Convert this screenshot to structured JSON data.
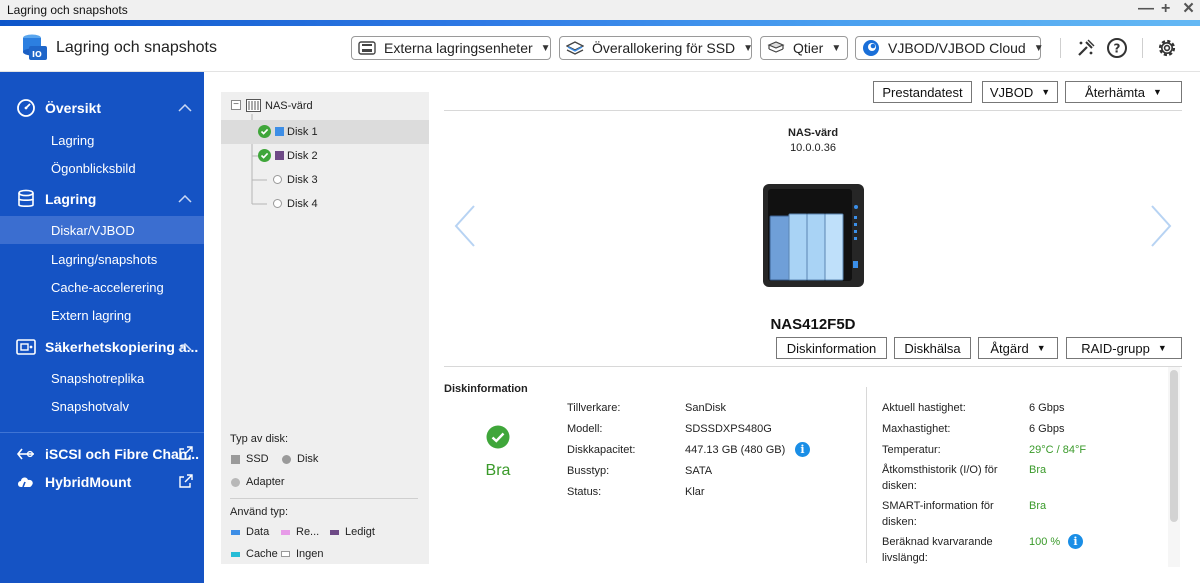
{
  "window": {
    "title": "Lagring och snapshots",
    "minimize": "—",
    "maximize": "+",
    "close": "×"
  },
  "header": {
    "app_name": "Lagring och snapshots",
    "buttons": {
      "external": "Externa lagringsenheter",
      "ssd": "Överallokering för SSD",
      "qtier": "Qtier",
      "vjbod": "VJBOD/VJBOD Cloud"
    },
    "accent": "#1553c4"
  },
  "sidebar": {
    "overview": "Översikt",
    "overview_items": [
      "Lagring",
      "Ögonblicksbild"
    ],
    "storage": "Lagring",
    "storage_items": [
      "Diskar/VJBOD",
      "Lagring/snapshots",
      "Cache-accelerering",
      "Extern lagring"
    ],
    "backup": "Säkerhetskopiering a...",
    "backup_items": [
      "Snapshotreplika",
      "Snapshotvalv"
    ],
    "iscsi": "iSCSI och Fibre Chan...",
    "hybridmount": "HybridMount"
  },
  "tree": {
    "root": "NAS-värd",
    "disks": [
      {
        "label": "Disk 1",
        "state": "ok",
        "color": "#3d8ee6"
      },
      {
        "label": "Disk 2",
        "state": "ok",
        "color": "#6e4a86"
      },
      {
        "label": "Disk 3",
        "state": "empty"
      },
      {
        "label": "Disk 4",
        "state": "empty"
      }
    ],
    "disk_type_title": "Typ av disk:",
    "disk_types": [
      "SSD",
      "Disk",
      "Adapter"
    ],
    "usage_title": "Använd typ:",
    "usage_types": [
      {
        "label": "Data",
        "color": "#3d8ee6"
      },
      {
        "label": "Re...",
        "color": "#e79be8"
      },
      {
        "label": "Ledigt",
        "color": "#6e4a86"
      },
      {
        "label": "Cache",
        "color": "#26bcd6"
      },
      {
        "label": "Ingen",
        "color": "#ffffff"
      }
    ]
  },
  "toolbar": {
    "perf_test": "Prestandatest",
    "vjbod": "VJBOD",
    "recover": "Återhämta"
  },
  "nas": {
    "name": "NAS-värd",
    "ip": "10.0.0.36",
    "model": "NAS412F5D"
  },
  "disk_actions": {
    "info": "Diskinformation",
    "health": "Diskhälsa",
    "action": "Åtgärd",
    "raid": "RAID-grupp"
  },
  "disk_info": {
    "title": "Diskinformation",
    "status": "Bra",
    "left": [
      {
        "label": "Tillverkare:",
        "value": "SanDisk"
      },
      {
        "label": "Modell:",
        "value": "SDSSDXPS480G"
      },
      {
        "label": "Diskkapacitet:",
        "value": "447.13 GB (480 GB)"
      },
      {
        "label": "Busstyp:",
        "value": "SATA"
      },
      {
        "label": "Status:",
        "value": "Klar"
      }
    ],
    "right": [
      {
        "label": "Aktuell hastighet:",
        "value": "6 Gbps"
      },
      {
        "label": "Maxhastighet:",
        "value": "6 Gbps"
      },
      {
        "label": "Temperatur:",
        "value": "29°C / 84°F"
      },
      {
        "label": "Åtkomsthistorik (I/O) för disken:",
        "value": "Bra"
      },
      {
        "label": "SMART-information för disken:",
        "value": "Bra"
      },
      {
        "label": "Beräknad kvarvarande livslängd:",
        "value": "100 %"
      }
    ],
    "green": "#3a9a2a"
  }
}
